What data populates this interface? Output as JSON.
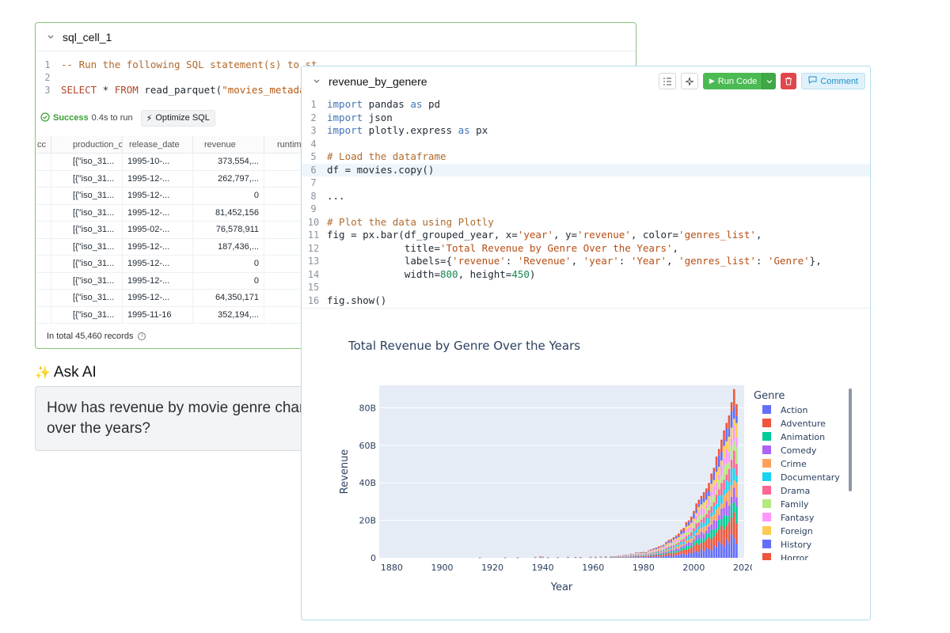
{
  "sql_cell": {
    "title": "sql_cell_1",
    "code_lines": [
      {
        "n": "1",
        "parts": [
          {
            "t": "-- Run the following SQL statement(s) to st",
            "c": "cm"
          }
        ]
      },
      {
        "n": "2",
        "parts": [
          {
            "t": "",
            "c": ""
          }
        ]
      },
      {
        "n": "3",
        "parts": [
          {
            "t": "SELECT",
            "c": "kw"
          },
          {
            "t": " * ",
            "c": ""
          },
          {
            "t": "FROM",
            "c": "kw"
          },
          {
            "t": " read_parquet(",
            "c": ""
          },
          {
            "t": "\"movies_metadata",
            "c": "str"
          }
        ]
      }
    ],
    "status_label": "Success",
    "status_duration": "0.4s to run",
    "optimize_label": "Optimize SQL",
    "columns": [
      "cc",
      "production_cc",
      "release_date",
      "revenue",
      "runtime"
    ],
    "rows": [
      [
        "[{\"iso_31...",
        "1995-10-...",
        "373,554,..."
      ],
      [
        "[{\"iso_31...",
        "1995-12-...",
        "262,797,..."
      ],
      [
        "[{\"iso_31...",
        "1995-12-...",
        "0"
      ],
      [
        "[{\"iso_31...",
        "1995-12-...",
        "81,452,156"
      ],
      [
        "[{\"iso_31...",
        "1995-02-...",
        "76,578,911"
      ],
      [
        "[{\"iso_31...",
        "1995-12-...",
        "187,436,..."
      ],
      [
        "[{\"iso_31...",
        "1995-12-...",
        "0"
      ],
      [
        "[{\"iso_31...",
        "1995-12-...",
        "0"
      ],
      [
        "[{\"iso_31...",
        "1995-12-...",
        "64,350,171"
      ],
      [
        "[{\"iso_31...",
        "1995-11-16",
        "352,194,..."
      ]
    ],
    "total_label": "In total 45,460 records"
  },
  "ask_ai": {
    "title": "Ask AI",
    "question": "How has revenue by movie genre changed over the years?"
  },
  "py_cell": {
    "title": "revenue_by_genere",
    "run_label": "Run Code",
    "comment_label": "Comment",
    "code_lines": [
      {
        "n": "1",
        "parts": [
          {
            "t": "import",
            "c": "pk"
          },
          {
            "t": " pandas ",
            "c": ""
          },
          {
            "t": "as",
            "c": "pk"
          },
          {
            "t": " pd",
            "c": ""
          }
        ]
      },
      {
        "n": "2",
        "parts": [
          {
            "t": "import",
            "c": "pk"
          },
          {
            "t": " json",
            "c": ""
          }
        ]
      },
      {
        "n": "3",
        "parts": [
          {
            "t": "import",
            "c": "pk"
          },
          {
            "t": " plotly.express ",
            "c": ""
          },
          {
            "t": "as",
            "c": "pk"
          },
          {
            "t": " px",
            "c": ""
          }
        ]
      },
      {
        "n": "4",
        "parts": [
          {
            "t": "",
            "c": ""
          }
        ]
      },
      {
        "n": "5",
        "parts": [
          {
            "t": "# Load the dataframe",
            "c": "pc"
          }
        ]
      },
      {
        "n": "6",
        "parts": [
          {
            "t": "df = movies.copy()",
            "c": ""
          }
        ],
        "active": true
      },
      {
        "n": "7",
        "parts": [
          {
            "t": "",
            "c": ""
          }
        ]
      },
      {
        "n": "8",
        "parts": [
          {
            "t": "...",
            "c": ""
          }
        ]
      },
      {
        "n": "9",
        "parts": [
          {
            "t": "",
            "c": ""
          }
        ]
      },
      {
        "n": "10",
        "parts": [
          {
            "t": "# Plot the data using Plotly",
            "c": "pc"
          }
        ]
      },
      {
        "n": "11",
        "parts": [
          {
            "t": "fig = px.bar(df_grouped_year, x=",
            "c": ""
          },
          {
            "t": "'year'",
            "c": "ps"
          },
          {
            "t": ", y=",
            "c": ""
          },
          {
            "t": "'revenue'",
            "c": "ps"
          },
          {
            "t": ", color=",
            "c": ""
          },
          {
            "t": "'genres_list'",
            "c": "ps"
          },
          {
            "t": ",",
            "c": ""
          }
        ]
      },
      {
        "n": "12",
        "parts": [
          {
            "t": "             title=",
            "c": ""
          },
          {
            "t": "'Total Revenue by Genre Over the Years'",
            "c": "ps"
          },
          {
            "t": ",",
            "c": ""
          }
        ]
      },
      {
        "n": "13",
        "parts": [
          {
            "t": "             labels={",
            "c": ""
          },
          {
            "t": "'revenue'",
            "c": "ps"
          },
          {
            "t": ": ",
            "c": ""
          },
          {
            "t": "'Revenue'",
            "c": "ps"
          },
          {
            "t": ", ",
            "c": ""
          },
          {
            "t": "'year'",
            "c": "ps"
          },
          {
            "t": ": ",
            "c": ""
          },
          {
            "t": "'Year'",
            "c": "ps"
          },
          {
            "t": ", ",
            "c": ""
          },
          {
            "t": "'genres_list'",
            "c": "ps"
          },
          {
            "t": ": ",
            "c": ""
          },
          {
            "t": "'Genre'",
            "c": "ps"
          },
          {
            "t": "},",
            "c": ""
          }
        ]
      },
      {
        "n": "14",
        "parts": [
          {
            "t": "             width=",
            "c": ""
          },
          {
            "t": "800",
            "c": "pn"
          },
          {
            "t": ", height=",
            "c": ""
          },
          {
            "t": "450",
            "c": "pn"
          },
          {
            "t": ")",
            "c": ""
          }
        ]
      },
      {
        "n": "15",
        "parts": [
          {
            "t": "",
            "c": ""
          }
        ]
      },
      {
        "n": "16",
        "parts": [
          {
            "t": "fig.show()",
            "c": ""
          }
        ]
      }
    ]
  },
  "chart_data": {
    "type": "bar",
    "stacked": true,
    "title": "Total Revenue by Genre Over the Years",
    "xlabel": "Year",
    "ylabel": "Revenue",
    "xlim": [
      1875,
      2020
    ],
    "ylim": [
      0,
      92
    ],
    "y_unit": "B",
    "x_ticks": [
      1880,
      1900,
      1920,
      1940,
      1960,
      1980,
      2000,
      2020
    ],
    "y_ticks": [
      {
        "v": 0,
        "label": "0"
      },
      {
        "v": 20,
        "label": "20B"
      },
      {
        "v": 40,
        "label": "40B"
      },
      {
        "v": 60,
        "label": "60B"
      },
      {
        "v": 80,
        "label": "80B"
      }
    ],
    "legend_title": "Genre",
    "legend_position": "right",
    "grid": true,
    "genres": [
      {
        "name": "Action",
        "color": "#636efa"
      },
      {
        "name": "Adventure",
        "color": "#ef553b"
      },
      {
        "name": "Animation",
        "color": "#00cc96"
      },
      {
        "name": "Comedy",
        "color": "#ab63fa"
      },
      {
        "name": "Crime",
        "color": "#ffa15a"
      },
      {
        "name": "Documentary",
        "color": "#19d3f3"
      },
      {
        "name": "Drama",
        "color": "#ff6692"
      },
      {
        "name": "Family",
        "color": "#b6e880"
      },
      {
        "name": "Fantasy",
        "color": "#ff97ff"
      },
      {
        "name": "Foreign",
        "color": "#fecb52"
      },
      {
        "name": "History",
        "color": "#636efa"
      },
      {
        "name": "Horror",
        "color": "#ef553b"
      }
    ],
    "years": [
      1915,
      1925,
      1930,
      1937,
      1939,
      1940,
      1942,
      1946,
      1950,
      1953,
      1955,
      1959,
      1961,
      1963,
      1965,
      1967,
      1968,
      1969,
      1970,
      1971,
      1972,
      1973,
      1974,
      1975,
      1976,
      1977,
      1978,
      1979,
      1980,
      1981,
      1982,
      1983,
      1984,
      1985,
      1986,
      1987,
      1988,
      1989,
      1990,
      1991,
      1992,
      1993,
      1994,
      1995,
      1996,
      1997,
      1998,
      1999,
      2000,
      2001,
      2002,
      2003,
      2004,
      2005,
      2006,
      2007,
      2008,
      2009,
      2010,
      2011,
      2012,
      2013,
      2014,
      2015,
      2016,
      2017
    ],
    "totals": [
      0.2,
      0.2,
      0.2,
      0.5,
      0.8,
      0.6,
      0.3,
      0.4,
      0.5,
      0.4,
      0.4,
      0.5,
      0.5,
      0.6,
      0.8,
      0.8,
      0.7,
      0.8,
      1.2,
      1.0,
      1.5,
      1.6,
      1.5,
      2.2,
      2.0,
      3.0,
      2.8,
      3.0,
      3.2,
      3.0,
      4.0,
      4.5,
      5.0,
      5.5,
      6.0,
      6.5,
      7.0,
      8.5,
      9.5,
      10.0,
      11.0,
      12.0,
      13.0,
      15.0,
      16.0,
      19.0,
      20.0,
      22.0,
      25.0,
      29.0,
      31.0,
      33.0,
      35.0,
      37.0,
      40.0,
      45.0,
      48.0,
      54.0,
      58.0,
      63.0,
      68.0,
      72.0,
      76.0,
      83.0,
      90.0,
      82.0
    ]
  }
}
